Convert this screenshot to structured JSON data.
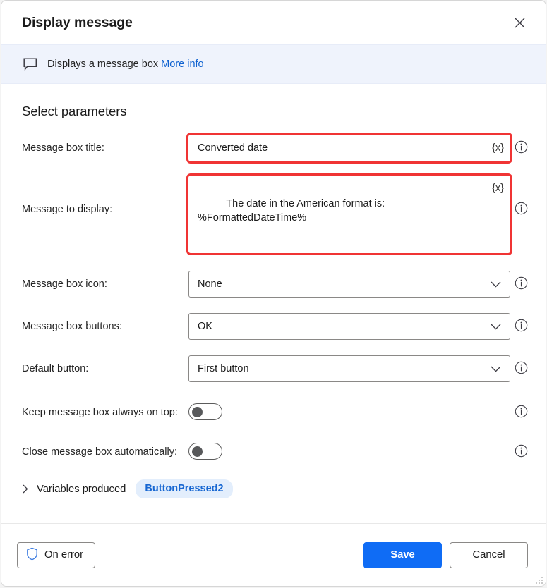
{
  "dialog": {
    "title": "Display message",
    "close_icon": "close-icon"
  },
  "banner": {
    "icon": "message-bubble-icon",
    "text": "Displays a message box",
    "link_label": "More info"
  },
  "main": {
    "section_title": "Select parameters",
    "fields": [
      {
        "label": "Message box title:",
        "type": "text",
        "value": "Converted date",
        "variable_button": "{x}",
        "highlighted": true,
        "info_icon": "info-icon"
      },
      {
        "label": "Message to display:",
        "type": "textarea",
        "value": "The date in the American format is:\n%FormattedDateTime%",
        "variable_button": "{x}",
        "highlighted": true,
        "info_icon": "info-icon"
      },
      {
        "label": "Message box icon:",
        "type": "dropdown",
        "value": "None",
        "highlighted": false,
        "info_icon": "info-icon"
      },
      {
        "label": "Message box buttons:",
        "type": "dropdown",
        "value": "OK",
        "highlighted": false,
        "info_icon": "info-icon"
      },
      {
        "label": "Default button:",
        "type": "dropdown",
        "value": "First button",
        "highlighted": false,
        "info_icon": "info-icon"
      },
      {
        "label": "Keep message box always on top:",
        "type": "toggle",
        "value": "Off",
        "info_icon": "info-icon"
      },
      {
        "label": "Close message box automatically:",
        "type": "toggle",
        "value": "Off",
        "info_icon": "info-icon"
      }
    ],
    "variables_produced": {
      "label": "Variables produced",
      "chip": "ButtonPressed2",
      "expanded": false
    }
  },
  "footer": {
    "on_error_label": "On error",
    "on_error_icon": "shield-icon",
    "save_label": "Save",
    "cancel_label": "Cancel"
  },
  "colors": {
    "accent": "#0f6cf5",
    "banner_bg": "#eff3fc",
    "link": "#0f62d0",
    "highlight_border": "#f03434",
    "chip_bg": "#e3eefc",
    "chip_text": "#1767d2",
    "shield": "#3a7ae0"
  }
}
